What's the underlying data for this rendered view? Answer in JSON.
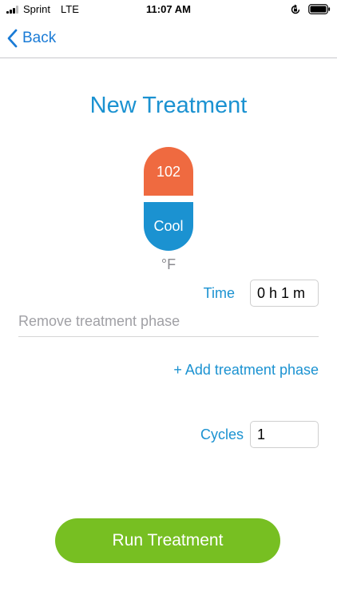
{
  "status_bar": {
    "carrier": "Sprint",
    "network": "LTE",
    "time": "11:07 AM"
  },
  "nav": {
    "back_label": "Back"
  },
  "page": {
    "title": "New Treatment"
  },
  "phase": {
    "temperature": "102",
    "mode": "Cool",
    "unit": "°F",
    "time_label": "Time",
    "time_value": "0 h 1 m",
    "remove_label": "Remove treatment phase"
  },
  "add_phase_label": "+ Add treatment phase",
  "cycles": {
    "label": "Cycles",
    "value": "1"
  },
  "run_button_label": "Run Treatment",
  "colors": {
    "accent_blue": "#1b92d1",
    "heat_orange": "#ef6a40",
    "run_green": "#77bf22",
    "ios_link_blue": "#1a7bd6"
  }
}
